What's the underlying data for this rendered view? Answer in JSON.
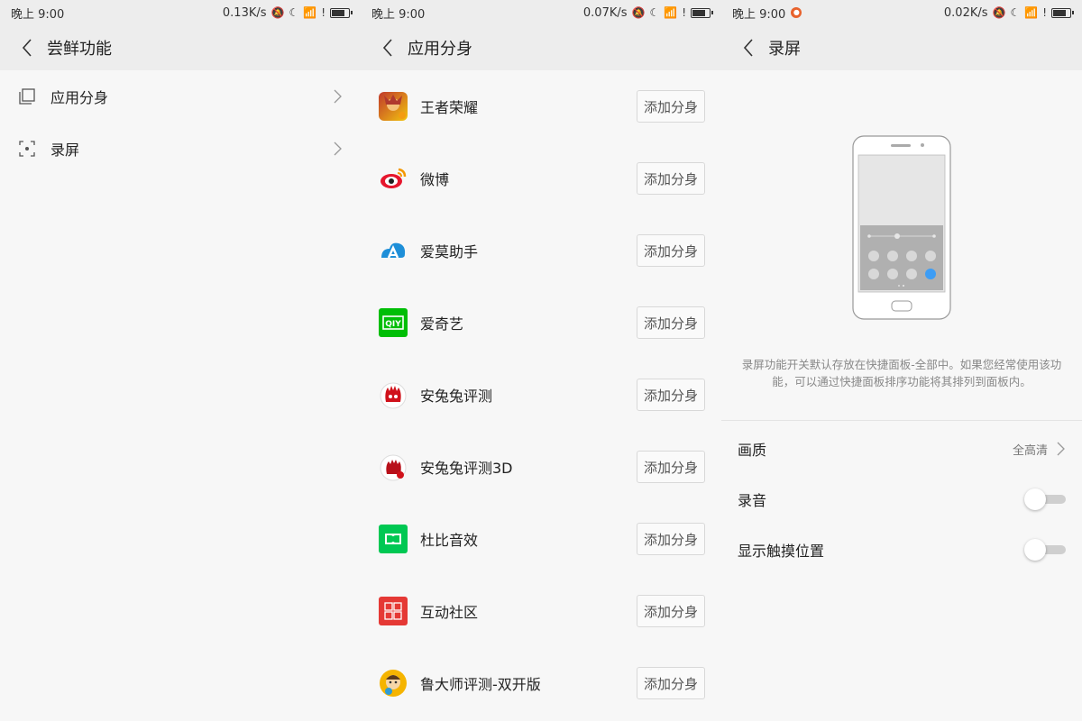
{
  "panels": [
    {
      "status": {
        "time": "晚上 9:00",
        "speed": "0.13K/s"
      },
      "title": "尝鲜功能",
      "items": [
        {
          "label": "应用分身",
          "icon": "copy-icon"
        },
        {
          "label": "录屏",
          "icon": "screen-record-icon"
        }
      ]
    },
    {
      "status": {
        "time": "晚上 9:00",
        "speed": "0.07K/s"
      },
      "title": "应用分身",
      "add_label": "添加分身",
      "apps": [
        {
          "name": "王者荣耀",
          "icon": "wangzhe-app-icon"
        },
        {
          "name": "微博",
          "icon": "weibo-app-icon"
        },
        {
          "name": "爱莫助手",
          "icon": "aimo-app-icon"
        },
        {
          "name": "爱奇艺",
          "icon": "iqiyi-app-icon"
        },
        {
          "name": "安兔兔评测",
          "icon": "antutu-app-icon"
        },
        {
          "name": "安兔兔评测3D",
          "icon": "antutu3d-app-icon"
        },
        {
          "name": "杜比音效",
          "icon": "dolby-app-icon"
        },
        {
          "name": "互动社区",
          "icon": "community-app-icon"
        },
        {
          "name": "鲁大师评测-双开版",
          "icon": "ludashi-app-icon"
        }
      ]
    },
    {
      "status": {
        "time": "晚上 9:00",
        "speed": "0.02K/s"
      },
      "title": "录屏",
      "description": "录屏功能开关默认存放在快捷面板-全部中。如果您经常使用该功能，可以通过快捷面板排序功能将其排列到面板内。",
      "settings": [
        {
          "label": "画质",
          "value": "全高清"
        },
        {
          "label": "录音",
          "on": false
        },
        {
          "label": "显示触摸位置",
          "on": false
        }
      ]
    }
  ],
  "colors": {
    "statusbar_bg": "#ededed",
    "page_bg": "#f7f7f7",
    "accent_blue": "#3d9df5",
    "notif_orange": "#e8622c"
  }
}
